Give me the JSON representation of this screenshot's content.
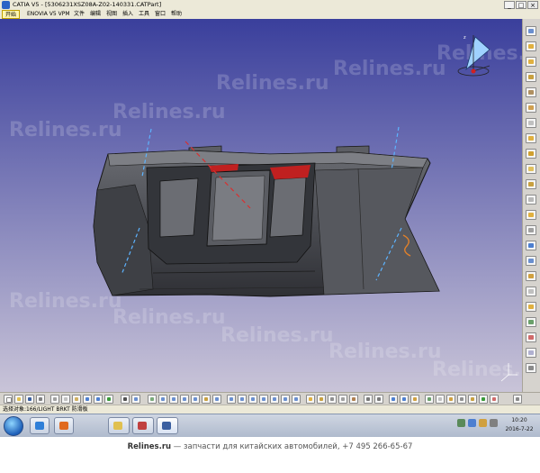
{
  "titlebar": {
    "title": "CATIA V5 - [5306231XSZ08A-Z02-140331.CATPart]",
    "minimize_glyph": "_",
    "maximize_glyph": "□",
    "close_glyph": "×"
  },
  "menubar": {
    "start_label": "开始",
    "items": [
      "ENOVIA V5 VPM",
      "文件",
      "编辑",
      "视图",
      "插入",
      "工具",
      "窗口",
      "帮助"
    ]
  },
  "viewport": {
    "watermark_text": "Relines.ru",
    "colors": {
      "background_top": "#3a3f9c",
      "background_bottom": "#c9c4d8",
      "part_fill": "#4d4f55",
      "part_edge": "#1a1a1a",
      "highlight_red": "#c02020",
      "axis_blue": "#5db3ff",
      "axis_red": "#d83030",
      "compass_fill": "#9fd2ff"
    }
  },
  "statusbar": {
    "message": "选择对象:166/LIGHT BRKT 防滑板"
  },
  "taskbar": {
    "icons": [
      "start-orb",
      "ie-icon",
      "media-player-icon",
      "explorer-icon",
      "catia-task-icon",
      "settings-task-icon"
    ],
    "clock_time": "10:20",
    "clock_date": "2016-7-22"
  },
  "footer": {
    "brand": "Relines.ru",
    "text": "— запчасти для китайских автомобилей, +7 495 266-65-67"
  }
}
